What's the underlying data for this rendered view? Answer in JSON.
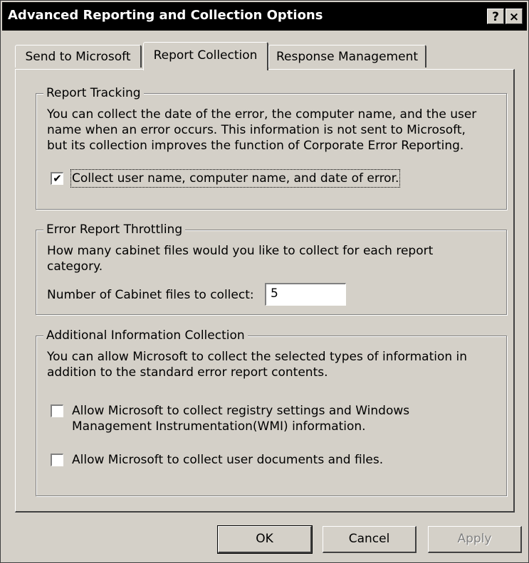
{
  "window": {
    "title": "Advanced Reporting and Collection Options",
    "help_glyph": "?",
    "close_glyph": "×"
  },
  "tabs": [
    {
      "label": "Send to Microsoft",
      "active": false
    },
    {
      "label": "Report Collection",
      "active": true
    },
    {
      "label": "Response Management",
      "active": false
    }
  ],
  "report_tracking": {
    "legend": "Report Tracking",
    "description_lines": [
      "You can collect the date of the error, the computer name, and the user",
      "name when an error occurs. This information is not sent to Microsoft,",
      "but its collection improves the function of Corporate Error Reporting."
    ],
    "checkbox_label": "Collect user name, computer name, and date of error.",
    "checkbox_checked": true,
    "check_glyph": "✔"
  },
  "throttling": {
    "legend": "Error Report Throttling",
    "description_lines": [
      "How many cabinet files would you like to collect for each report",
      "category."
    ],
    "field_label": "Number of Cabinet files to collect:",
    "field_value": "5"
  },
  "additional": {
    "legend": "Additional Information Collection",
    "description_lines": [
      "You can allow Microsoft to collect the selected types of information in",
      "addition to the standard error report contents."
    ],
    "option1_lines": [
      "Allow Microsoft to collect registry settings and Windows",
      "Management Instrumentation(WMI) information."
    ],
    "option1_checked": false,
    "option2_label": "Allow Microsoft to collect user documents and files.",
    "option2_checked": false
  },
  "buttons": {
    "ok": "OK",
    "cancel": "Cancel",
    "apply": "Apply"
  }
}
